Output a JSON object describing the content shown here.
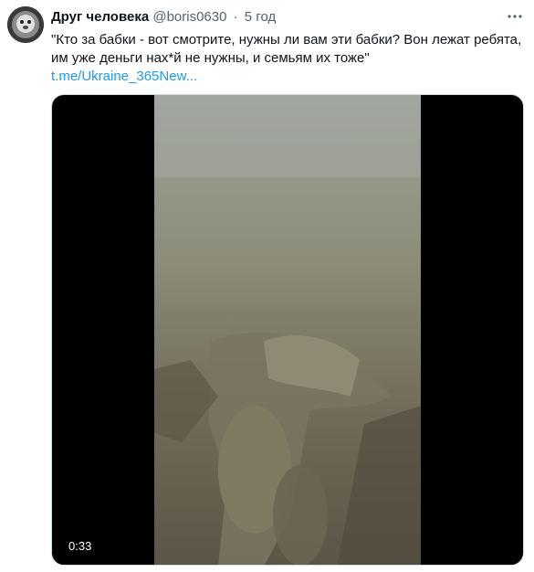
{
  "tweet": {
    "author_name": "Друг человека",
    "handle": "@boris0630",
    "separator": "·",
    "time": "5 год",
    "text": "\"Кто за бабки - вот смотрите, нужны ли вам эти бабки? Вон лежат ребята, им уже деньги нах*й не нужны, и семьям их тоже\"",
    "link": "t.me/Ukraine_365New...",
    "more_icon": "ellipsis-icon",
    "avatar_icon": "avatar"
  },
  "media": {
    "type": "video",
    "duration": "0:33"
  },
  "colors": {
    "text": "#0f1419",
    "secondary": "#536471",
    "link": "#1d9bf0"
  }
}
